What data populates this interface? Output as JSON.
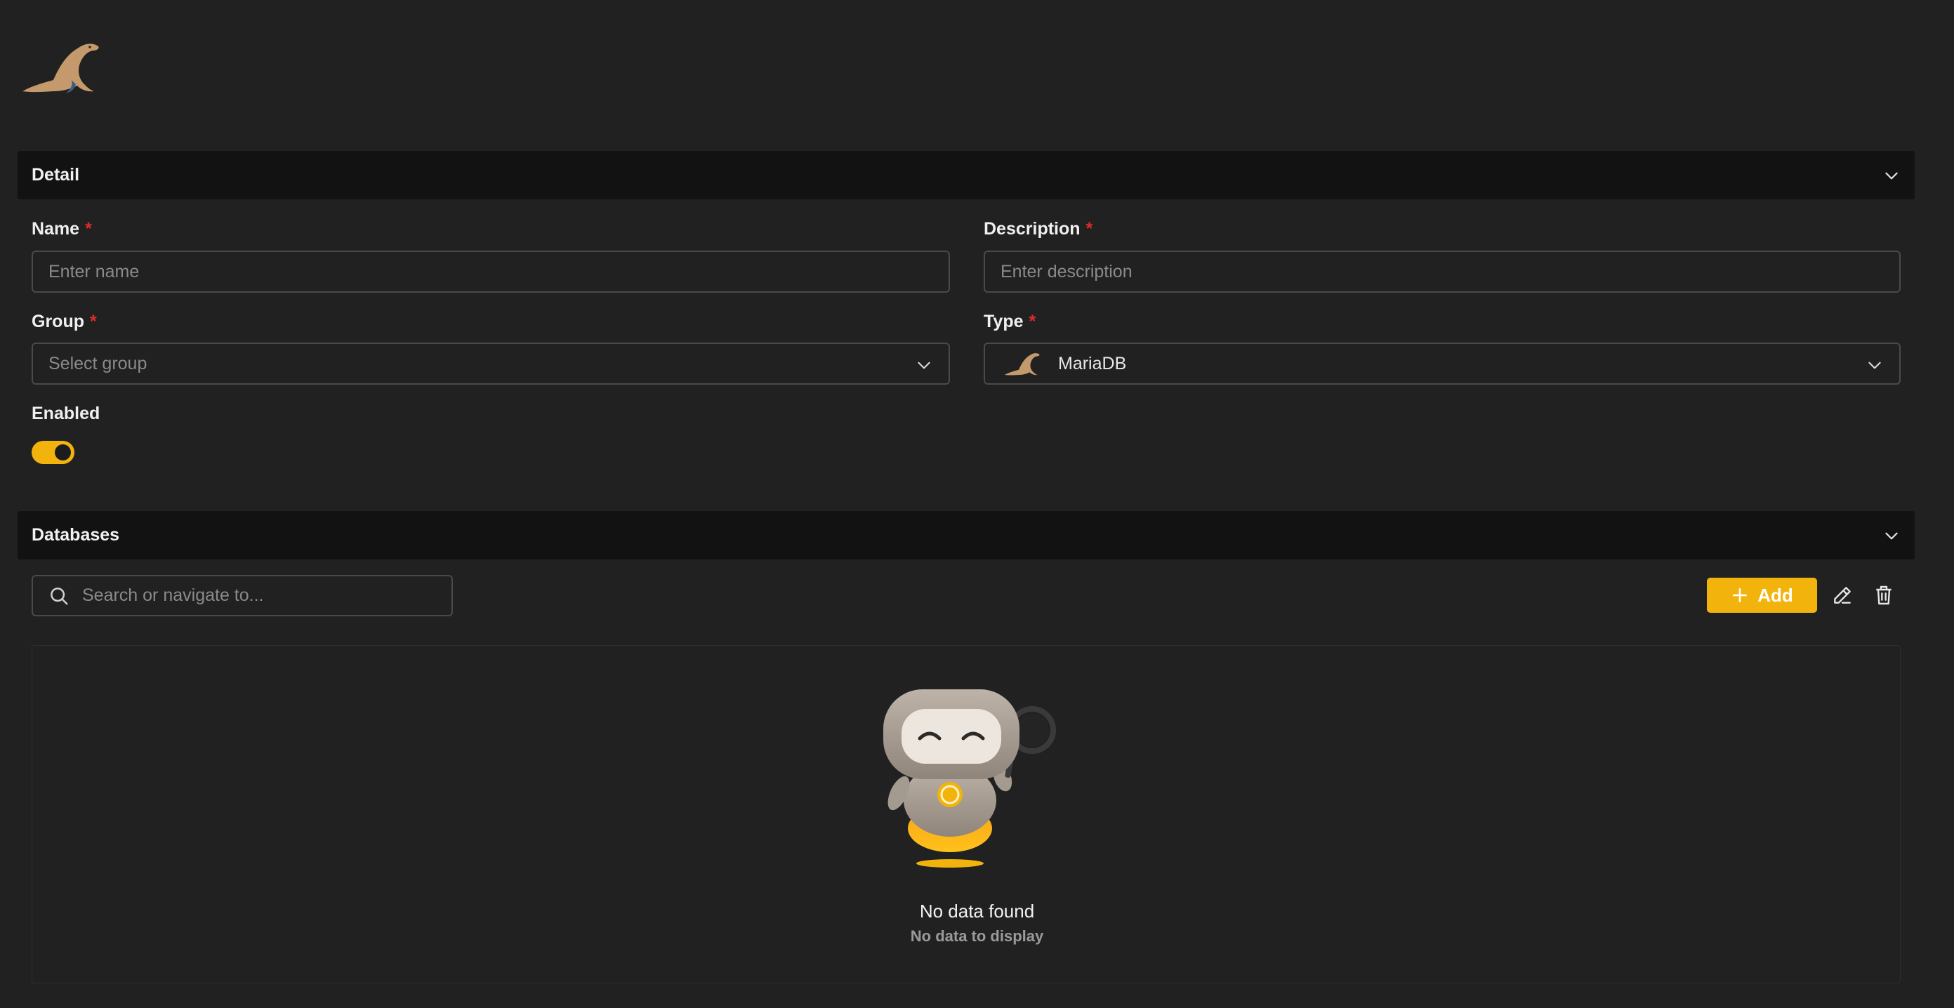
{
  "logo": {
    "icon": "mariadb-seal-logo",
    "color": "#c49a6c"
  },
  "detail_section": {
    "title": "Detail"
  },
  "form": {
    "name": {
      "label": "Name",
      "required_mark": "*",
      "placeholder": "Enter name",
      "value": ""
    },
    "description": {
      "label": "Description",
      "required_mark": "*",
      "placeholder": "Enter description",
      "value": ""
    },
    "group": {
      "label": "Group",
      "required_mark": "*",
      "placeholder": "Select group"
    },
    "type": {
      "label": "Type",
      "required_mark": "*",
      "value": "MariaDB",
      "icon": "mariadb-seal-icon"
    },
    "enabled": {
      "label": "Enabled",
      "on": true
    }
  },
  "databases_section": {
    "title": "Databases"
  },
  "toolbar": {
    "search_placeholder": "Search or navigate to...",
    "add_label": "Add",
    "edit_icon": "pencil-icon",
    "delete_icon": "trash-icon"
  },
  "empty_state": {
    "title": "No data found",
    "subtitle": "No data to display",
    "illustration": "robot-with-magnifier"
  },
  "colors": {
    "background": "#212121",
    "header_bg": "#121212",
    "accent": "#f2b40c",
    "required": "#e02b2b",
    "border": "#4a4a4a"
  }
}
